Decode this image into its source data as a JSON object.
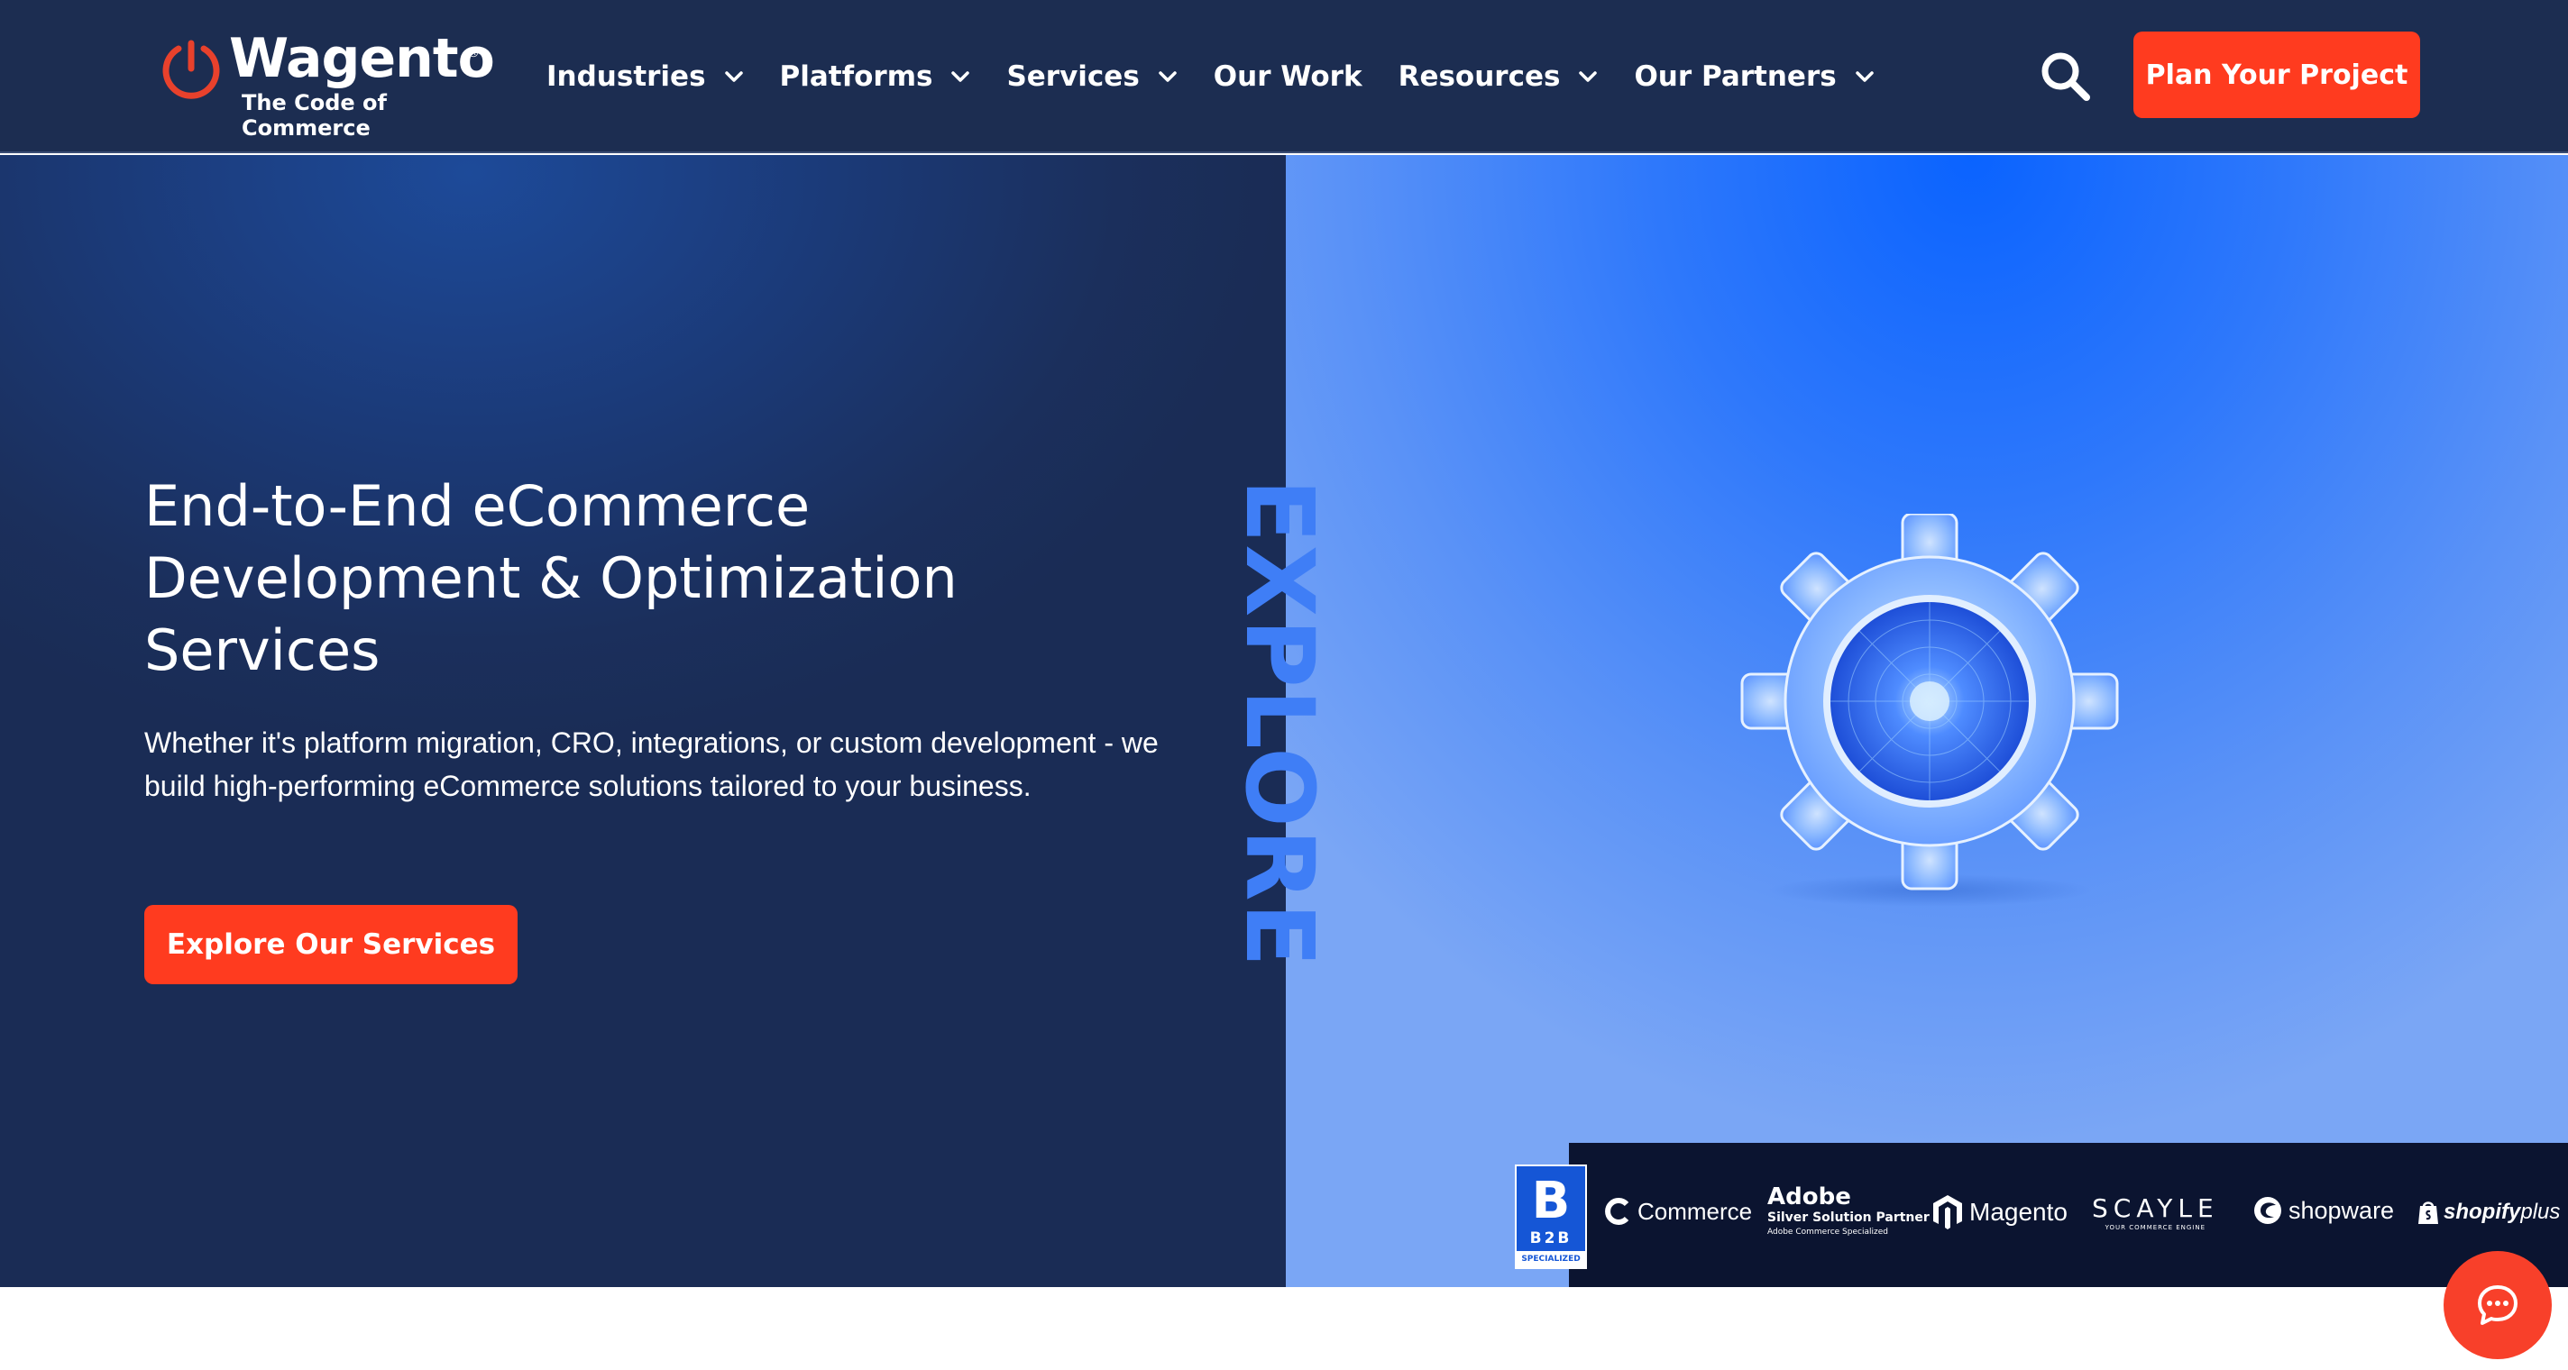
{
  "header": {
    "logo": {
      "name": "Wagento",
      "tagline": "The Code of Commerce",
      "registered": "®"
    },
    "nav": [
      {
        "label": "Industries",
        "has_dropdown": true
      },
      {
        "label": "Platforms",
        "has_dropdown": true
      },
      {
        "label": "Services",
        "has_dropdown": true
      },
      {
        "label": "Our Work",
        "has_dropdown": false
      },
      {
        "label": "Resources",
        "has_dropdown": true
      },
      {
        "label": "Our Partners",
        "has_dropdown": true
      }
    ],
    "search_icon": "search-icon",
    "cta_label": "Plan Your Project"
  },
  "hero": {
    "title": "End-to-End eCommerce Development & Optimization Services",
    "description": "Whether it's platform migration, CRO, integrations, or custom development - we build high-performing eCommerce solutions tailored to your business.",
    "cta_label": "Explore Our Services",
    "vertical_word": "EXPLORE",
    "image_icon": "gear-icon"
  },
  "partners": {
    "b2b": {
      "letter": "B",
      "code": "B2B",
      "badge": "SPECIALIZED"
    },
    "commerce": "Commerce",
    "adobe": {
      "name": "Adobe",
      "line1": "Silver Solution Partner",
      "line2": "Adobe Commerce Specialized"
    },
    "magento": "Magento",
    "scayle": {
      "name": "SCAYLE",
      "tagline": "YOUR COMMERCE ENGINE"
    },
    "shopware": "shopware",
    "shopify": {
      "name": "shopify",
      "plus": "plus"
    }
  },
  "chat": {
    "icon": "chat-bubble-icon"
  },
  "colors": {
    "header_bg": "#1c2d51",
    "accent": "#ff3b1f",
    "hero_left_bg": "#1b3a78",
    "hero_right_bg": "#2e78fb",
    "partner_strip_bg": "#0b1430"
  }
}
